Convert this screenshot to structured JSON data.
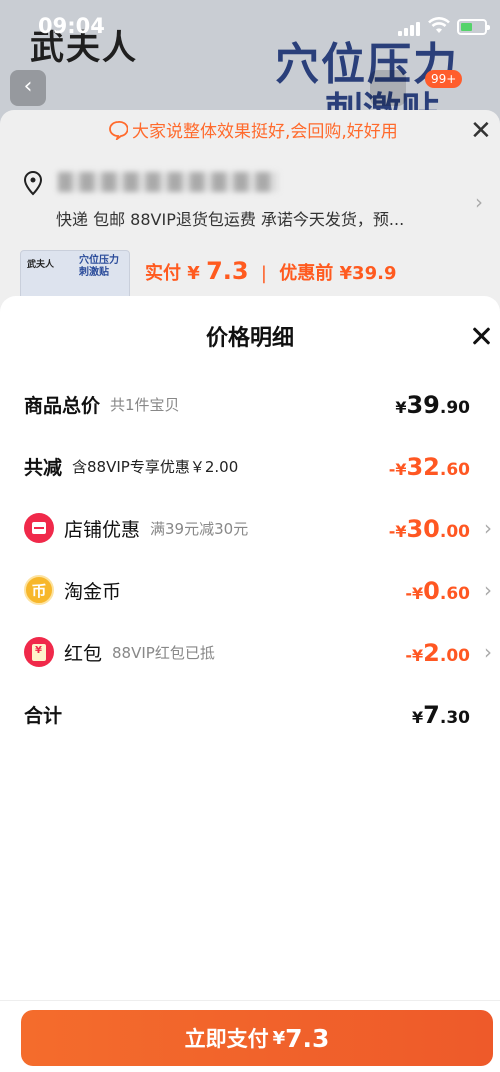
{
  "status_bar": {
    "time": "09:04"
  },
  "background": {
    "brand": "武夫人",
    "banner_title": "穴位压力",
    "banner_subtitle": "刺激贴",
    "cart_badge": "99+",
    "review_tip": "大家说整体效果挺好,会回购,好好用",
    "delivery_info": "快递 包邮 88VIP退货包运费 承诺今天发货，预...",
    "thumb_brand": "武夫人",
    "thumb_title": "穴位压力刺激贴",
    "actual_pay_label": "实付",
    "actual_pay_currency": "¥",
    "actual_pay_value": "7.3",
    "original_price_label": "优惠前",
    "original_price": "¥39.9"
  },
  "modal": {
    "title": "价格明细",
    "rows": [
      {
        "label": "商品总价",
        "sub": "共1件宝贝",
        "currency": "¥",
        "int": "39",
        "dec": ".90",
        "sign": "",
        "icon": ""
      },
      {
        "label": "共减",
        "sub": "含88VIP专享优惠￥2.00",
        "currency": "¥",
        "int": "32",
        "dec": ".60",
        "sign": "-",
        "icon": ""
      },
      {
        "label": "店铺优惠",
        "sub": "满39元减30元",
        "currency": "¥",
        "int": "30",
        "dec": ".00",
        "sign": "-",
        "icon": "shop-coupon-icon"
      },
      {
        "label": "淘金币",
        "sub": "",
        "currency": "¥",
        "int": "0",
        "dec": ".60",
        "sign": "-",
        "icon": "gold-coin-icon"
      },
      {
        "label": "红包",
        "sub": "88VIP红包已抵",
        "currency": "¥",
        "int": "2",
        "dec": ".00",
        "sign": "-",
        "icon": "red-packet-icon"
      },
      {
        "label": "合计",
        "sub": "",
        "currency": "¥",
        "int": "7",
        "dec": ".30",
        "sign": "",
        "icon": ""
      }
    ],
    "coin_glyph": "币"
  },
  "pay_button": {
    "label": "立即支付",
    "currency": "¥",
    "value": "7.3"
  },
  "colors": {
    "accent": "#ff5722",
    "pay_button": "#f0622a",
    "coupon_red": "#f0294a",
    "coin_gold": "#f7b72b"
  }
}
